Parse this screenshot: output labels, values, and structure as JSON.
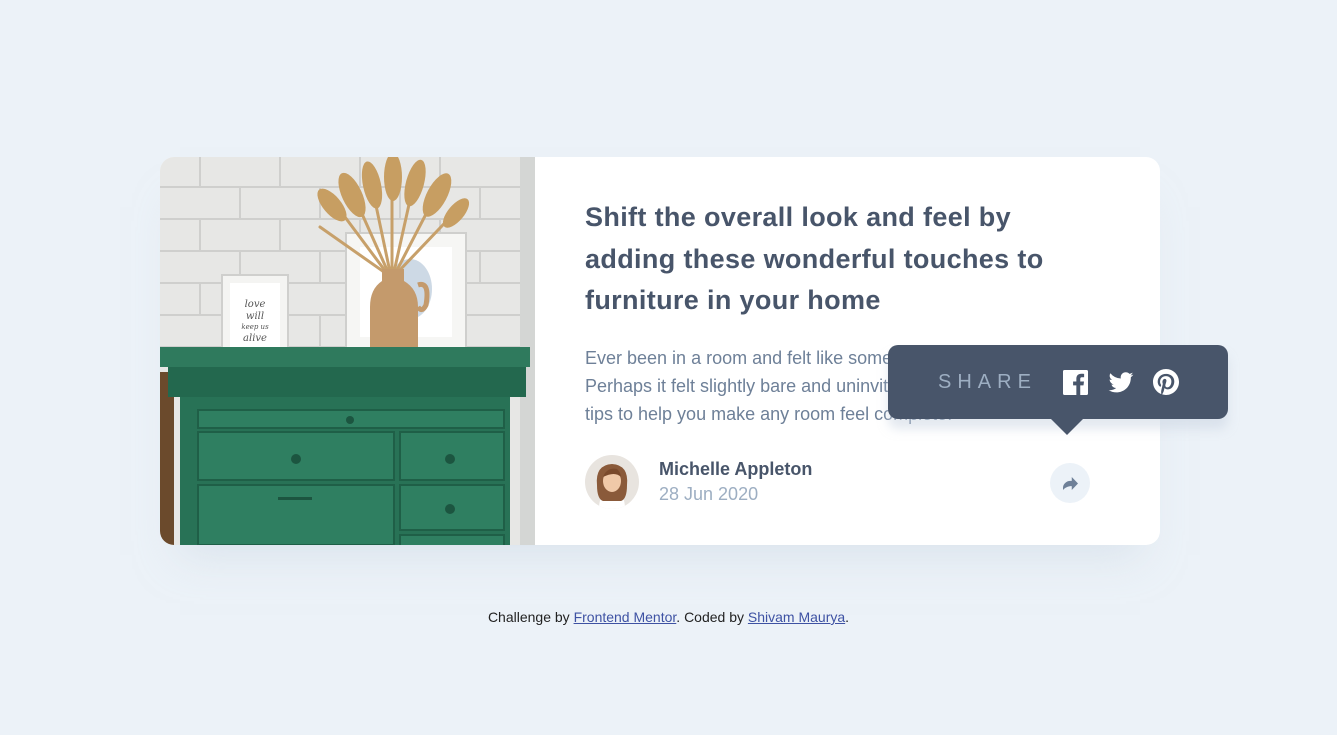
{
  "card": {
    "title": "Shift the overall look and feel by adding these wonderful touches to furniture in your home",
    "description": "Ever been in a room and felt like something was missing? Perhaps it felt slightly bare and uninviting. I’ve got some simple tips to help you make any room feel complete.",
    "author_name": "Michelle Appleton",
    "date": "28 Jun 2020"
  },
  "share": {
    "label": "SHARE",
    "icons": [
      "share-icon",
      "facebook-icon",
      "twitter-icon",
      "pinterest-icon"
    ]
  },
  "image": {
    "frame_text": "love will keep us alive"
  },
  "attribution": {
    "prefix": "Challenge by",
    "link1": "Frontend Mentor",
    "middle": ". Coded by",
    "link2": "Shivam Maurya",
    "suffix": "."
  },
  "colors": {
    "background": "#ecf2f8",
    "card": "#ffffff",
    "title": "#48556a",
    "text": "#6e8098",
    "muted": "#9daec2",
    "tooltip": "#48556a",
    "link": "#3e52a3"
  }
}
